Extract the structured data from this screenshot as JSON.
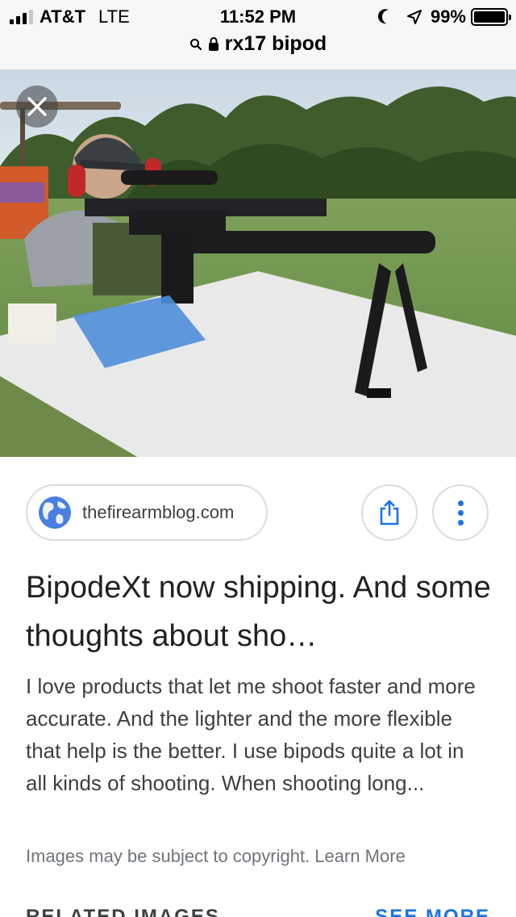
{
  "status_bar": {
    "carrier": "AT&T",
    "network": "LTE",
    "time": "11:52 PM",
    "battery": "99%",
    "signal_bars": 4,
    "signal_bars_active": 3
  },
  "url_bar": {
    "query": "rx17 bipod"
  },
  "image": {
    "close_icon": "close-icon"
  },
  "source": {
    "domain": "thefirearmblog.com",
    "icon": "globe-icon"
  },
  "actions": {
    "share_icon": "share-icon",
    "more_icon": "more-vert-icon"
  },
  "result": {
    "title": "BipodeXt now shipping. And some thoughts about sho…",
    "description": "I love products that let me shoot faster and more accurate. And the lighter and the more flexible that help is the better. I use bipods quite a lot in all kinds of shooting. When shooting long..."
  },
  "footer": {
    "copyright_text": "Images may be subject to copyright.",
    "learn_more": "Learn More",
    "related_label": "RELATED IMAGES",
    "see_more": "SEE MORE"
  },
  "colors": {
    "accent": "#1a73e8",
    "chrome": "#f7f7f7",
    "border": "#dadce0"
  }
}
